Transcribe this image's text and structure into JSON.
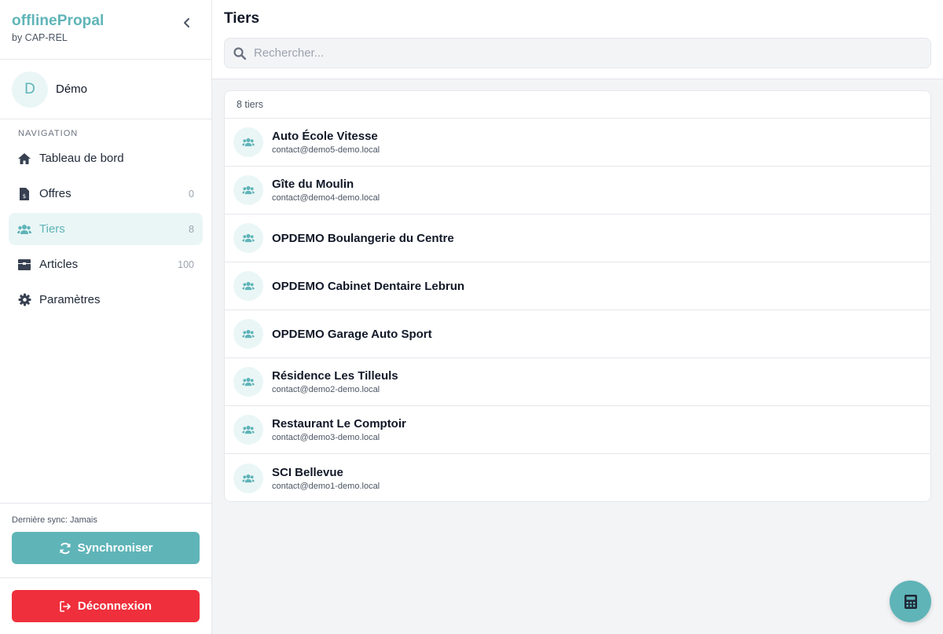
{
  "brand": {
    "name": "offlinePropal",
    "sub": "by CAP-REL"
  },
  "user": {
    "initial": "D",
    "name": "Démo"
  },
  "nav": {
    "title": "NAVIGATION",
    "items": [
      {
        "label": "Tableau de bord",
        "count": "",
        "icon": "home-icon"
      },
      {
        "label": "Offres",
        "count": "0",
        "icon": "invoice-icon"
      },
      {
        "label": "Tiers",
        "count": "8",
        "icon": "users-icon",
        "active": true
      },
      {
        "label": "Articles",
        "count": "100",
        "icon": "box-icon"
      },
      {
        "label": "Paramètres",
        "count": "",
        "icon": "gear-icon"
      }
    ]
  },
  "sync": {
    "last": "Dernière sync: Jamais",
    "button": "Synchroniser"
  },
  "logout": {
    "button": "Déconnexion"
  },
  "page": {
    "title": "Tiers"
  },
  "search": {
    "placeholder": "Rechercher..."
  },
  "list": {
    "count": "8 tiers",
    "rows": [
      {
        "name": "Auto École Vitesse",
        "email": "contact@demo5-demo.local"
      },
      {
        "name": "Gîte du Moulin",
        "email": "contact@demo4-demo.local"
      },
      {
        "name": "OPDEMO Boulangerie du Centre",
        "email": ""
      },
      {
        "name": "OPDEMO Cabinet Dentaire Lebrun",
        "email": ""
      },
      {
        "name": "OPDEMO Garage Auto Sport",
        "email": ""
      },
      {
        "name": "Résidence Les Tilleuls",
        "email": "contact@demo2-demo.local"
      },
      {
        "name": "Restaurant Le Comptoir",
        "email": "contact@demo3-demo.local"
      },
      {
        "name": "SCI Bellevue",
        "email": "contact@demo1-demo.local"
      }
    ]
  },
  "colors": {
    "accent": "#5fb4b8",
    "danger": "#ef2f3c"
  }
}
